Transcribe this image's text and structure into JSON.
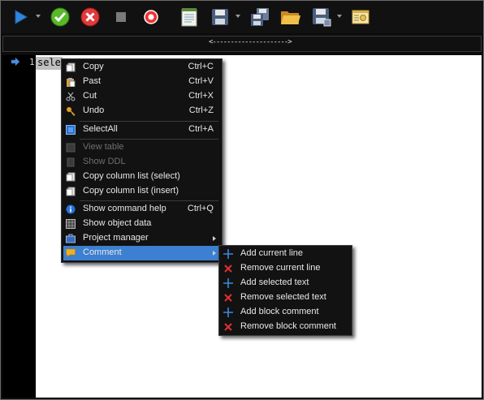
{
  "toolbar": {
    "buttons": [
      {
        "name": "execute-icon",
        "color": "#2a7fd4"
      },
      {
        "name": "commit-icon",
        "color": "#4caf2a"
      },
      {
        "name": "rollback-icon",
        "color": "#d93030"
      },
      {
        "name": "stop-icon",
        "color": "#7a7a7a"
      },
      {
        "name": "record-icon",
        "color": "#e03030"
      },
      {
        "name": "notes-icon",
        "color": "#e8e8d8"
      },
      {
        "name": "save-icon",
        "color": "#5a6e8a"
      },
      {
        "name": "save-all-icon",
        "color": "#5a6e8a"
      },
      {
        "name": "open-folder-icon",
        "color": "#e0a82e"
      },
      {
        "name": "save-as-icon",
        "color": "#5a6e8a"
      },
      {
        "name": "properties-icon",
        "color": "#e8c050"
      }
    ]
  },
  "splitter": {
    "handle_text": "<--------------------->"
  },
  "editor": {
    "line_number": "1",
    "code_text": "sele"
  },
  "context_menu": {
    "items": [
      {
        "label": "Copy",
        "shortcut": "Ctrl+C",
        "icon": "copy-icon",
        "enabled": true
      },
      {
        "label": "Past",
        "shortcut": "Ctrl+V",
        "icon": "paste-icon",
        "enabled": true
      },
      {
        "label": "Cut",
        "shortcut": "Ctrl+X",
        "icon": "scissors-icon",
        "enabled": true
      },
      {
        "label": "Undo",
        "shortcut": "Ctrl+Z",
        "icon": "key-icon",
        "enabled": true
      },
      {
        "label": "SelectAll",
        "shortcut": "Ctrl+A",
        "icon": "select-all-icon",
        "enabled": true
      },
      {
        "label": "View table",
        "shortcut": "",
        "icon": "table-icon",
        "enabled": false
      },
      {
        "label": "Show DDL",
        "shortcut": "",
        "icon": "ddl-icon",
        "enabled": false
      },
      {
        "label": "Copy column list (select)",
        "shortcut": "",
        "icon": "copy-icon",
        "enabled": true
      },
      {
        "label": "Copy column list (insert)",
        "shortcut": "",
        "icon": "copy-icon",
        "enabled": true
      },
      {
        "label": "Show command help",
        "shortcut": "Ctrl+Q",
        "icon": "info-icon",
        "enabled": true
      },
      {
        "label": "Show object data",
        "shortcut": "",
        "icon": "grid-icon",
        "enabled": true
      },
      {
        "label": "Project manager",
        "shortcut": "",
        "icon": "briefcase-icon",
        "enabled": true,
        "has_submenu": true
      },
      {
        "label": "Comment",
        "shortcut": "",
        "icon": "comment-icon",
        "enabled": true,
        "has_submenu": true,
        "highlighted": true
      }
    ],
    "highlight_color": "#3d7fd1"
  },
  "comment_submenu": {
    "items": [
      {
        "label": "Add current line",
        "icon": "plus-icon"
      },
      {
        "label": "Remove current line",
        "icon": "x-icon"
      },
      {
        "label": "Add selected text",
        "icon": "plus-icon"
      },
      {
        "label": "Remove selected text",
        "icon": "x-icon"
      },
      {
        "label": "Add block comment",
        "icon": "plus-icon"
      },
      {
        "label": "Remove block comment",
        "icon": "x-icon"
      }
    ]
  }
}
